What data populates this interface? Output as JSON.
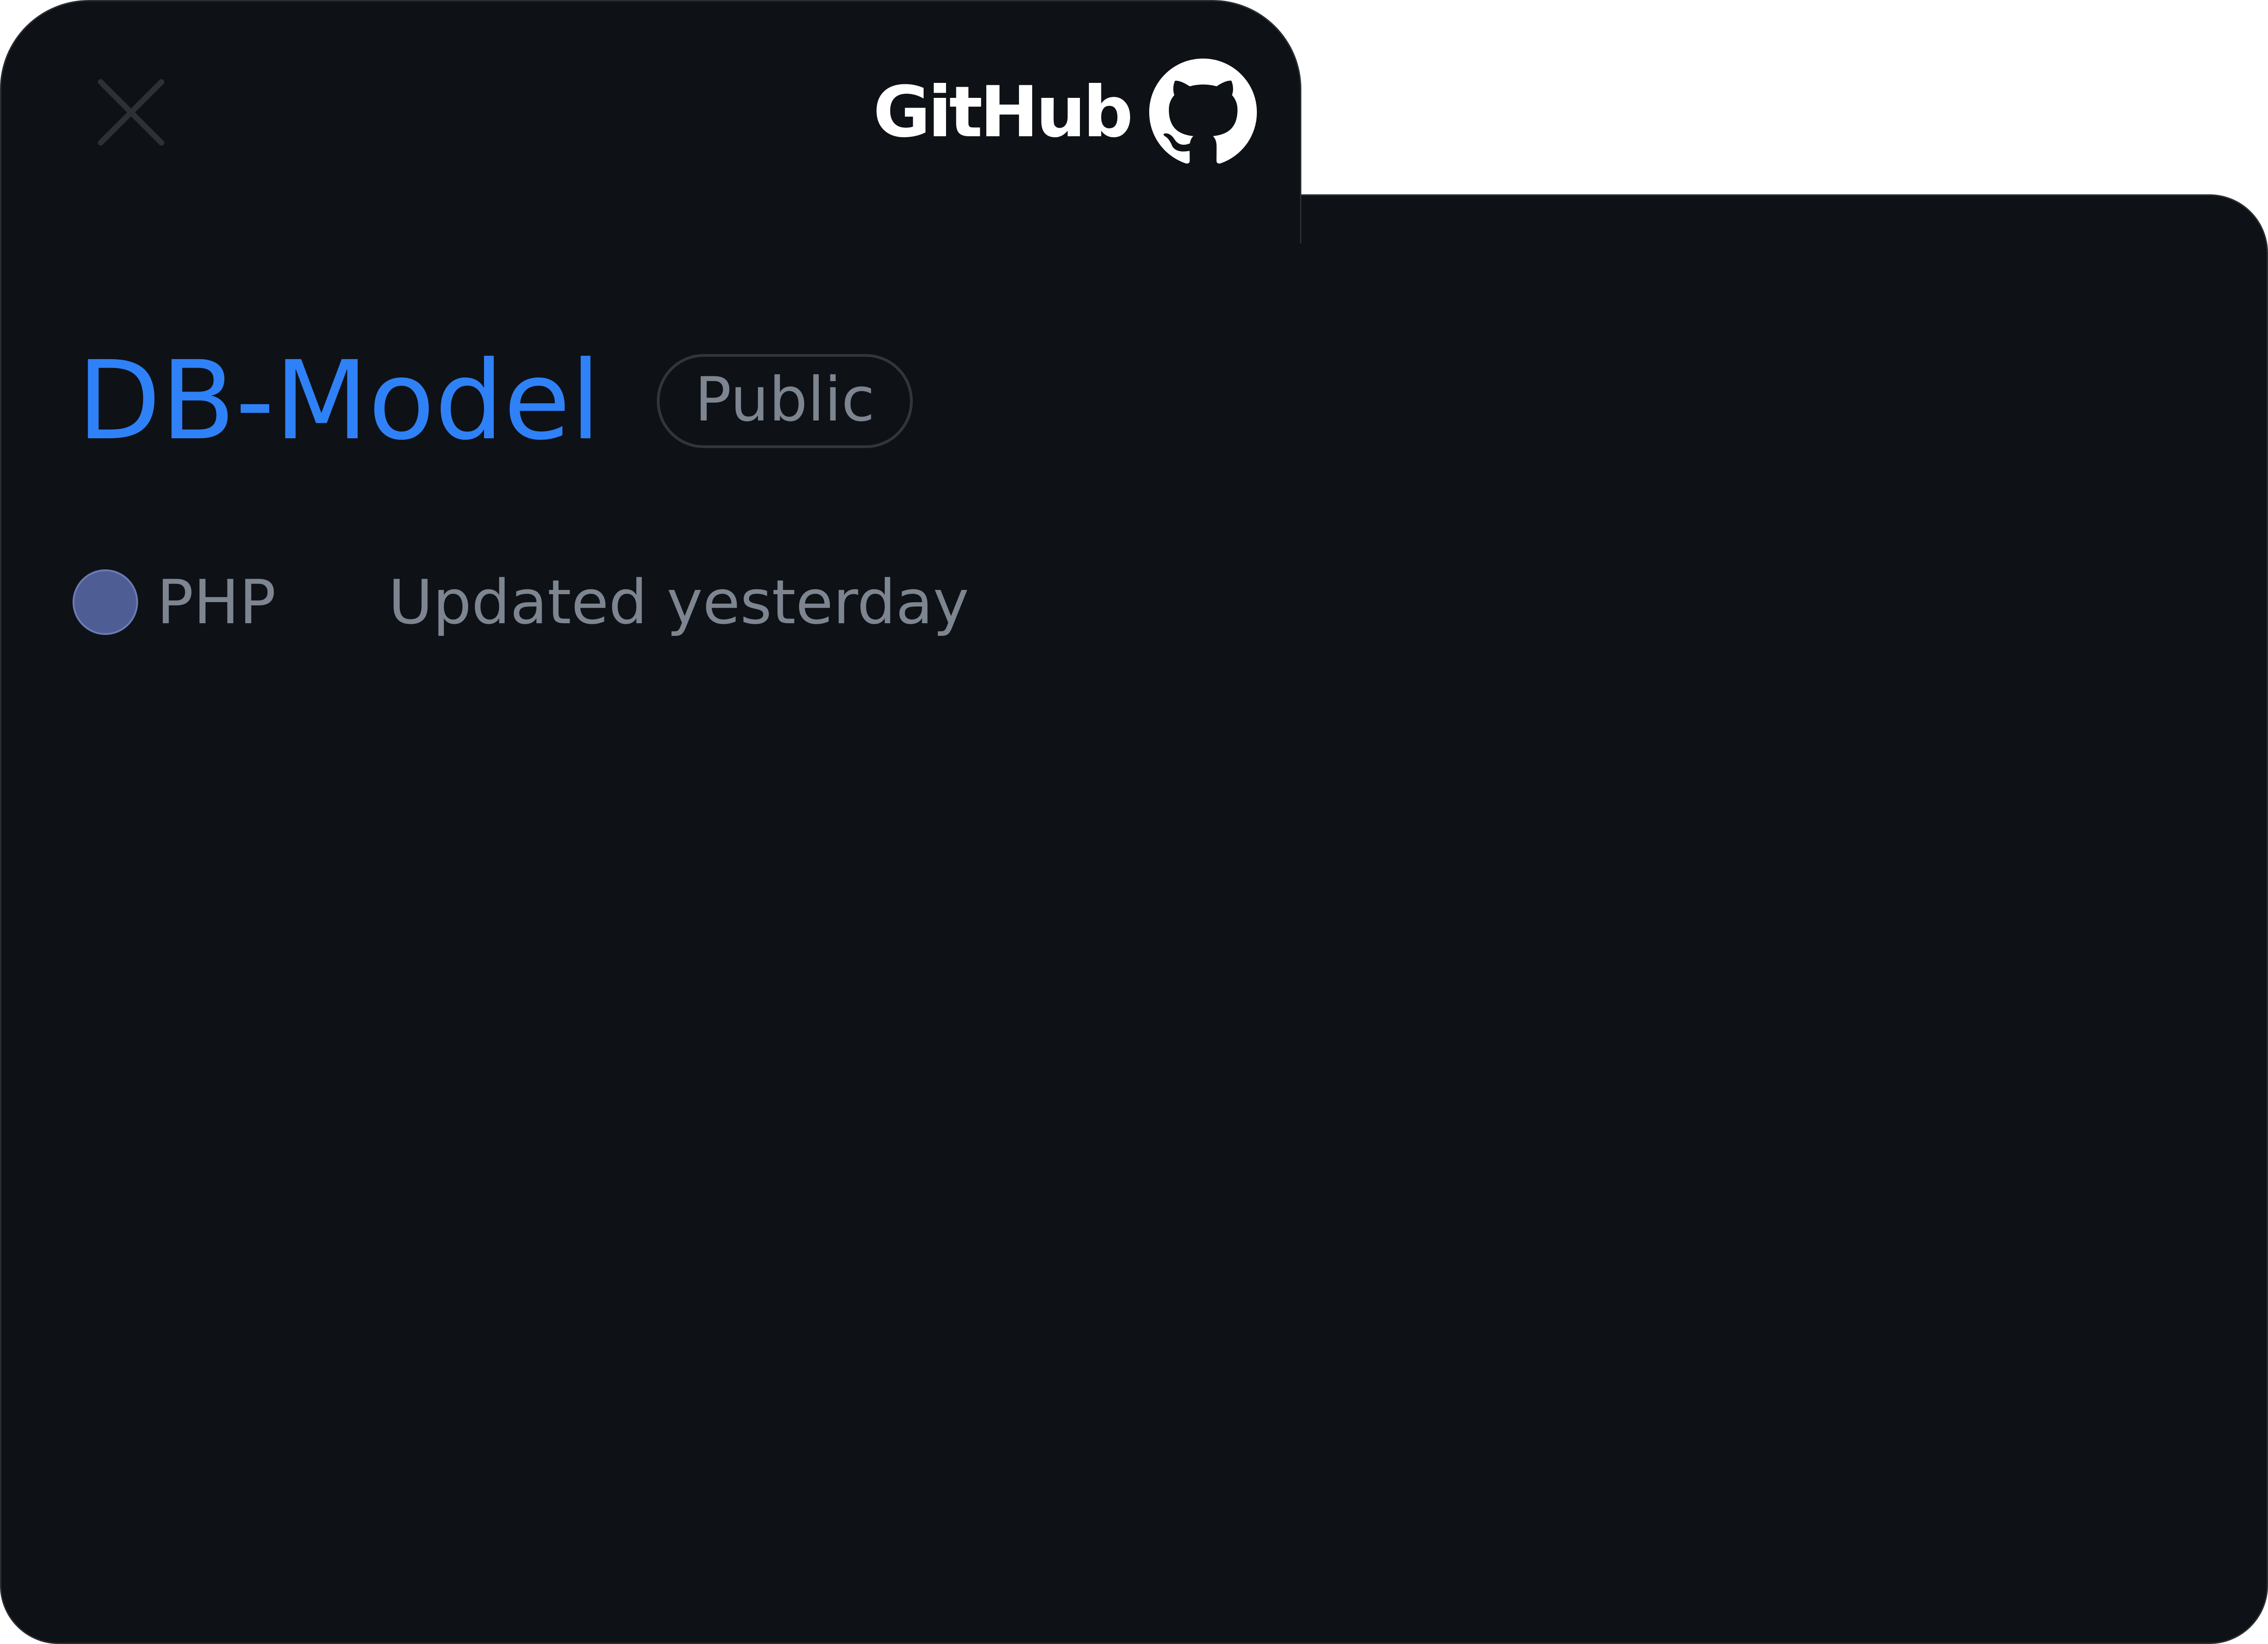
{
  "header": {
    "close_icon": "close-icon",
    "brand_text": "GitHub",
    "brand_icon": "github-octocat-icon"
  },
  "repo": {
    "name": "DB-Model",
    "visibility": "Public",
    "language": "PHP",
    "language_color": "#4F5D95",
    "updated": "Updated yesterday"
  },
  "colors": {
    "background": "#0E1116",
    "link": "#2F81F7",
    "muted": "#7D8590",
    "border": "#30363D"
  }
}
